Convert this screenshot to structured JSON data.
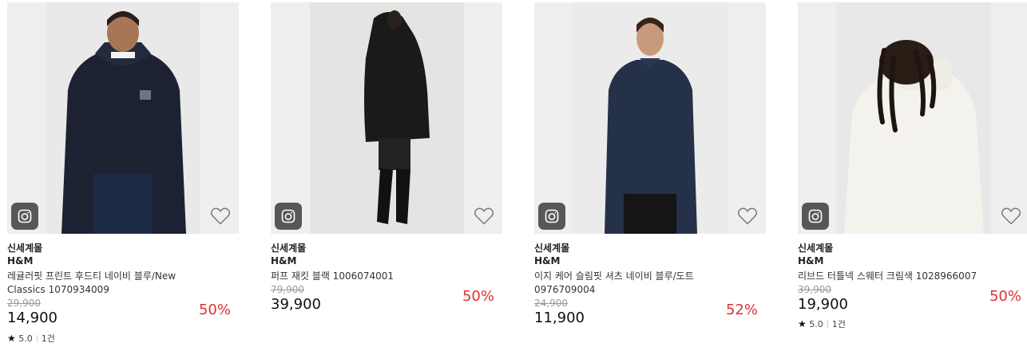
{
  "products": [
    {
      "store": "신세계몰",
      "brand": "H&M",
      "name": "레귤러핏 프린트 후드티 네이비 블루/New Classics 1070934009",
      "original_price": "29,900",
      "price": "14,900",
      "discount": "50%",
      "rating": "5.0",
      "reviews": "1건",
      "colors": {
        "bg": "#e9e9e9",
        "garment": "#1d2233"
      }
    },
    {
      "store": "신세계몰",
      "brand": "H&M",
      "name": "퍼프 재킷 블랙 1006074001",
      "original_price": "79,900",
      "price": "39,900",
      "discount": "50%",
      "colors": {
        "bg": "#e4e4e2",
        "garment": "#1a1a1a"
      }
    },
    {
      "store": "신세계몰",
      "brand": "H&M",
      "name": "이지 케어 슬림핏 셔츠 네이비 블루/도트 0976709004",
      "original_price": "24,900",
      "price": "11,900",
      "discount": "52%",
      "colors": {
        "bg": "#ebebeb",
        "garment": "#253049"
      }
    },
    {
      "store": "신세계몰",
      "brand": "H&M",
      "name": "리브드 터틀넥 스웨터 크림색 1028966007",
      "original_price": "39,900",
      "price": "19,900",
      "discount": "50%",
      "rating": "5.0",
      "reviews": "1건",
      "colors": {
        "bg": "#e8e8e8",
        "garment": "#f4f2ec"
      }
    }
  ],
  "icons": {
    "camera": "camera-icon",
    "wishlist": "heart-outline-icon",
    "rating": "star-icon"
  }
}
